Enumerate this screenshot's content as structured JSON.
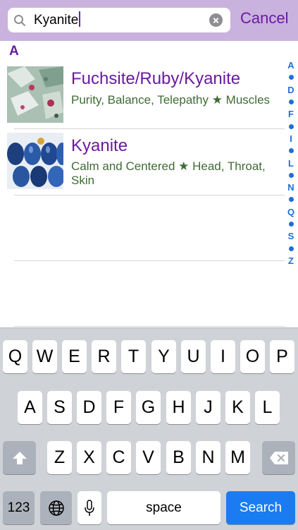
{
  "search": {
    "value": "Kyanite",
    "cancel_label": "Cancel"
  },
  "section": {
    "letter": "A"
  },
  "results": [
    {
      "title": "Fuchsite/Ruby/Kyanite",
      "subtitle": "Purity, Balance, Telepathy ★ Muscles"
    },
    {
      "title": "Kyanite",
      "subtitle": "Calm and Centered ★ Head, Throat, Skin"
    }
  ],
  "index": [
    "A",
    "•",
    "D",
    "•",
    "F",
    "•",
    "I",
    "•",
    "L",
    "•",
    "N",
    "•",
    "Q",
    "•",
    "S",
    "•",
    "Z"
  ],
  "keyboard": {
    "row1": [
      "Q",
      "W",
      "E",
      "R",
      "T",
      "Y",
      "U",
      "I",
      "O",
      "P"
    ],
    "row2": [
      "A",
      "S",
      "D",
      "F",
      "G",
      "H",
      "J",
      "K",
      "L"
    ],
    "row3": [
      "Z",
      "X",
      "C",
      "V",
      "B",
      "N",
      "M"
    ],
    "numbers_label": "123",
    "space_label": "space",
    "search_label": "Search"
  },
  "colors": {
    "accent": "#6a1aa1",
    "subtitle": "#3f6b35",
    "index": "#1f6fd6",
    "search_key": "#1a7cf0",
    "header_bg": "#c9b2de"
  }
}
